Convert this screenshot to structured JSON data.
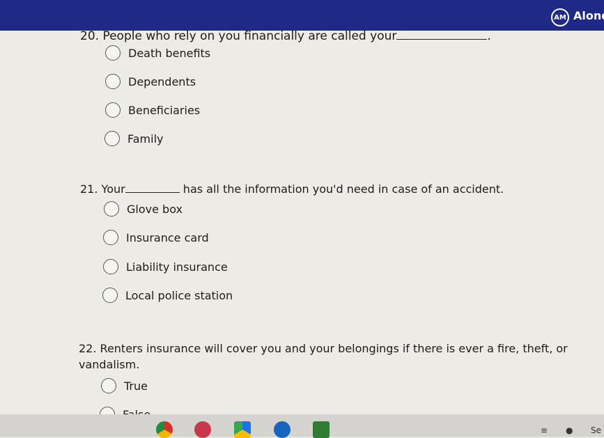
{
  "header": {
    "avatar_initials": "AM",
    "user_name": "Alond"
  },
  "questions": [
    {
      "number": "20.",
      "text_before": "People who rely on you financially are called your",
      "text_after": ".",
      "options": [
        "Death benefits",
        "Dependents",
        "Beneficiaries",
        "Family"
      ]
    },
    {
      "number": "21.",
      "text_before": "Your",
      "text_after": "has all the information you'd need in case of an accident.",
      "options": [
        "Glove box",
        "Insurance card",
        "Liability insurance",
        "Local police station"
      ]
    },
    {
      "number": "22.",
      "text_line1": "Renters insurance will cover you and your belongings if there is ever a fire, theft, or",
      "text_line2": "vandalism.",
      "options": [
        "True",
        "False"
      ]
    }
  ],
  "taskbar": {
    "apps": [
      "chrome-icon",
      "art-app-icon",
      "drive-icon",
      "docs-app-icon",
      "classroom-icon"
    ],
    "tray_text": "Se"
  },
  "colors": {
    "header": "#1e2a86",
    "background": "#ecebe6"
  }
}
